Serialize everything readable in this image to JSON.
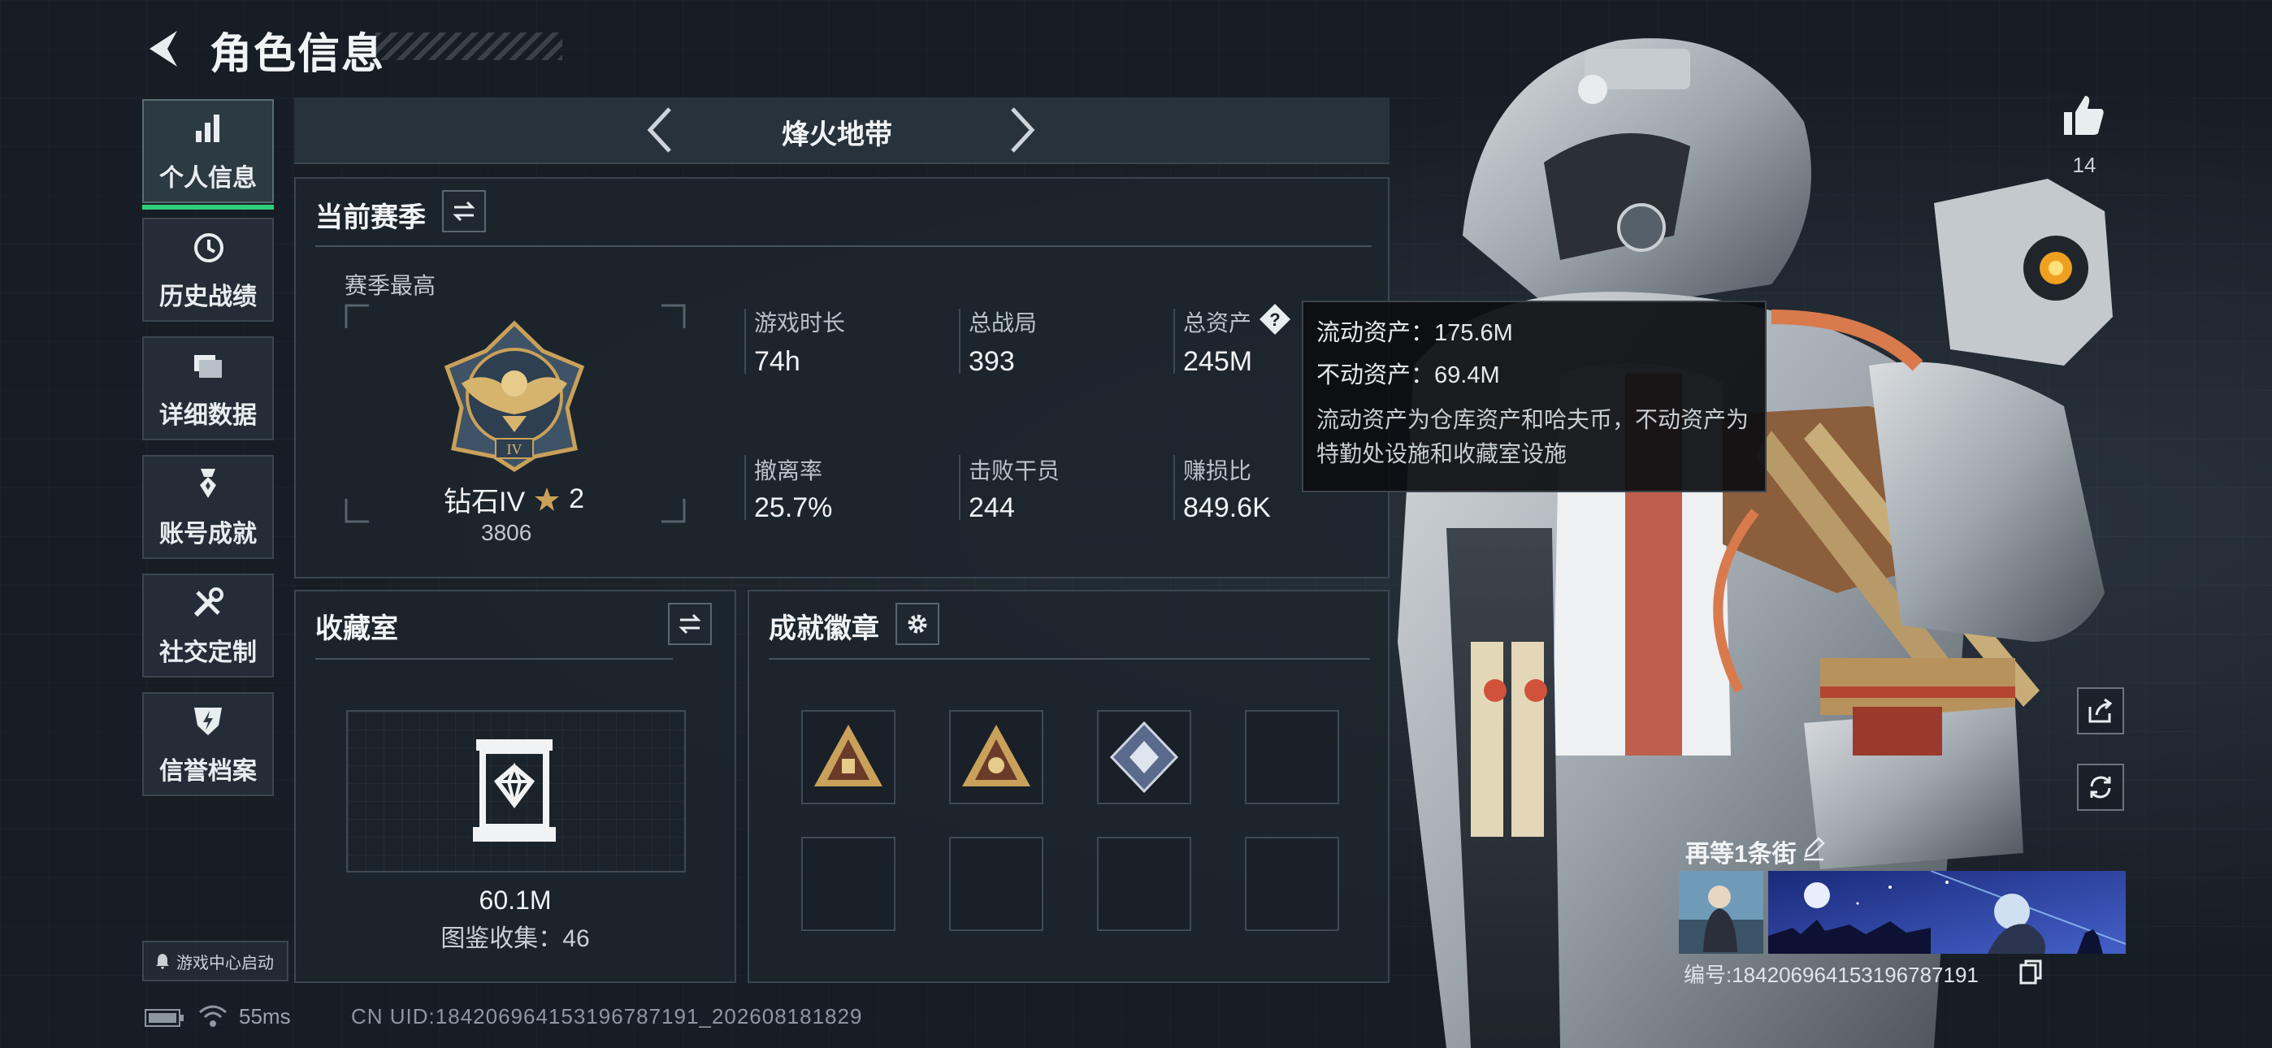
{
  "header": {
    "title": "角色信息"
  },
  "nav": {
    "items": [
      {
        "label": "个人信息",
        "icon": "bar-chart-icon",
        "active": true
      },
      {
        "label": "历史战绩",
        "icon": "history-clock-icon"
      },
      {
        "label": "详细数据",
        "icon": "folder-icon"
      },
      {
        "label": "账号成就",
        "icon": "achievement-medal-icon"
      },
      {
        "label": "社交定制",
        "icon": "tools-icon"
      },
      {
        "label": "信誉档案",
        "icon": "shield-lightning-icon"
      }
    ],
    "launch_button": "游戏中心启动"
  },
  "mode": {
    "label": "烽火地带"
  },
  "season": {
    "title": "当前赛季",
    "best_label": "赛季最高",
    "rank_name": "钻石IV",
    "rank_stars": "2",
    "rank_score": "3806",
    "stats": [
      {
        "label": "游戏时长",
        "value": "74h"
      },
      {
        "label": "总战局",
        "value": "393"
      },
      {
        "label": "总资产",
        "value": "245M"
      },
      {
        "label": "撤离率",
        "value": "25.7%"
      },
      {
        "label": "击败干员",
        "value": "244"
      },
      {
        "label": "赚损比",
        "value": "849.6K"
      }
    ]
  },
  "tooltip": {
    "liquid": "流动资产：175.6M",
    "fixed": "不动资产：69.4M",
    "description": "流动资产为仓库资产和哈夫币，不动资产为特勤处设施和收藏室设施"
  },
  "collection": {
    "title": "收藏室",
    "value": "60.1M",
    "catalog": "图鉴收集：46"
  },
  "badges": {
    "title": "成就徽章",
    "filled": [
      "gold-triangle-badge",
      "gold-triangle-eye-badge",
      "blue-diamond-badge"
    ],
    "slot_count": 8
  },
  "profile": {
    "likes": "14",
    "player_name": "再等1条街",
    "player_id": "编号:1842069641531967871​91"
  },
  "status": {
    "ping": "55ms",
    "uid": "CN UID:18420696415319678719​1_202608181829"
  },
  "colors": {
    "active_accent": "#2fd07a",
    "gold": "#c9a15a",
    "background": "#171d24"
  }
}
